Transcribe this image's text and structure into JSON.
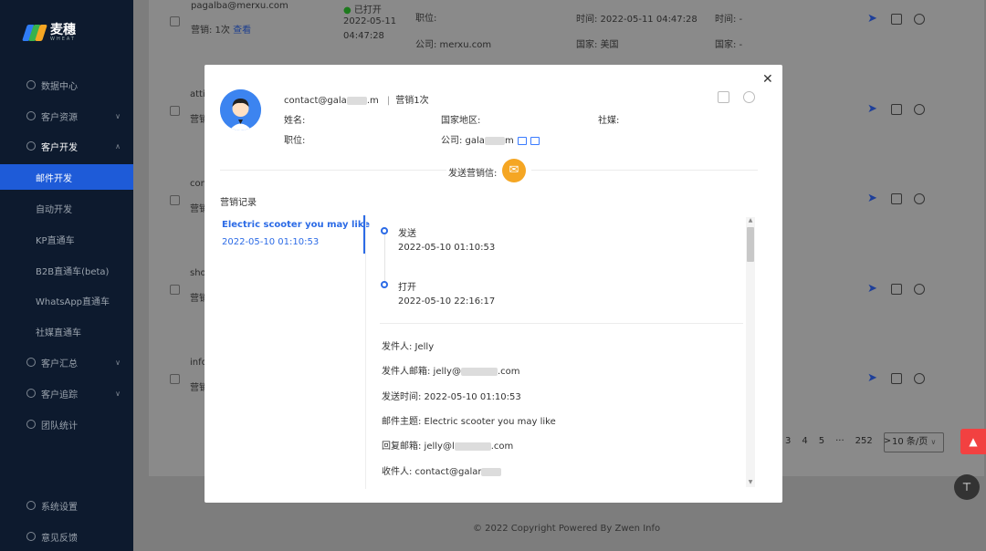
{
  "sidebar": {
    "brand": "麦穗",
    "brand_sub": "WHEAT",
    "items": [
      {
        "label": "数据中心",
        "icon": "dashboard-icon"
      },
      {
        "label": "客户资源",
        "icon": "customer-icon"
      },
      {
        "label": "客户开发",
        "icon": "develop-icon"
      },
      {
        "label": "客户汇总",
        "icon": "summary-icon"
      },
      {
        "label": "客户追踪",
        "icon": "track-icon"
      },
      {
        "label": "团队统计",
        "icon": "stats-icon"
      }
    ],
    "sub_items": [
      "邮件开发",
      "自动开发",
      "KP直通车",
      "B2B直通车(beta)",
      "WhatsApp直通车",
      "社媒直通车"
    ],
    "bottom_items": [
      "系统设置",
      "意见反馈"
    ]
  },
  "background": {
    "row1": {
      "email": "pagalba@merxu.com",
      "marketing": "营销: 1次",
      "view": "查看",
      "status": "已打开",
      "status_date": "2022-05-11",
      "status_time": "04:47:28",
      "position": "职位:",
      "company": "公司: merxu.com",
      "time": "时间: 2022-05-11 04:47:28",
      "country": "国家: 美国",
      "time2": "时间: -",
      "country2": "国家: -"
    },
    "truncated": [
      "atti",
      "营销",
      "con",
      "营销",
      "sho",
      "营销",
      "info",
      "营销"
    ],
    "pager": [
      "3",
      "4",
      "5",
      "···",
      "252",
      ">"
    ],
    "page_size": "10 条/页",
    "footer": "© 2022 Copyright Powered By Zwen Info"
  },
  "modal": {
    "contact": "contact@gala",
    "contact_suffix": ".m",
    "marketing_count": "营销1次",
    "name_label": "姓名:",
    "country_label": "国家地区:",
    "social_label": "社媒:",
    "position_label": "职位:",
    "company_label": "公司: gala",
    "company_suffix": "m",
    "send_label": "发送营销信:",
    "records_title": "营销记录",
    "record": {
      "title": "Electric scooter you may like",
      "time": "2022-05-10 01:10:53"
    },
    "timeline": [
      {
        "label": "发送",
        "time": "2022-05-10 01:10:53"
      },
      {
        "label": "打开",
        "time": "2022-05-10 22:16:17"
      }
    ],
    "details": {
      "sender": "发件人: Jelly",
      "sender_email": "发件人邮箱: jelly@",
      "sender_email_suffix": ".com",
      "send_time": "发送时间: 2022-05-10 01:10:53",
      "subject": "邮件主题: Electric scooter you may like",
      "reply_email": "回复邮箱: jelly@l",
      "reply_suffix": ".com",
      "recipient": "收件人: contact@galar"
    }
  },
  "colors": {
    "sidebar": "#0d1a2e",
    "active": "#1e5bd8",
    "link": "#2c6be6",
    "mail": "#f5a623",
    "bell": "#f24141"
  }
}
